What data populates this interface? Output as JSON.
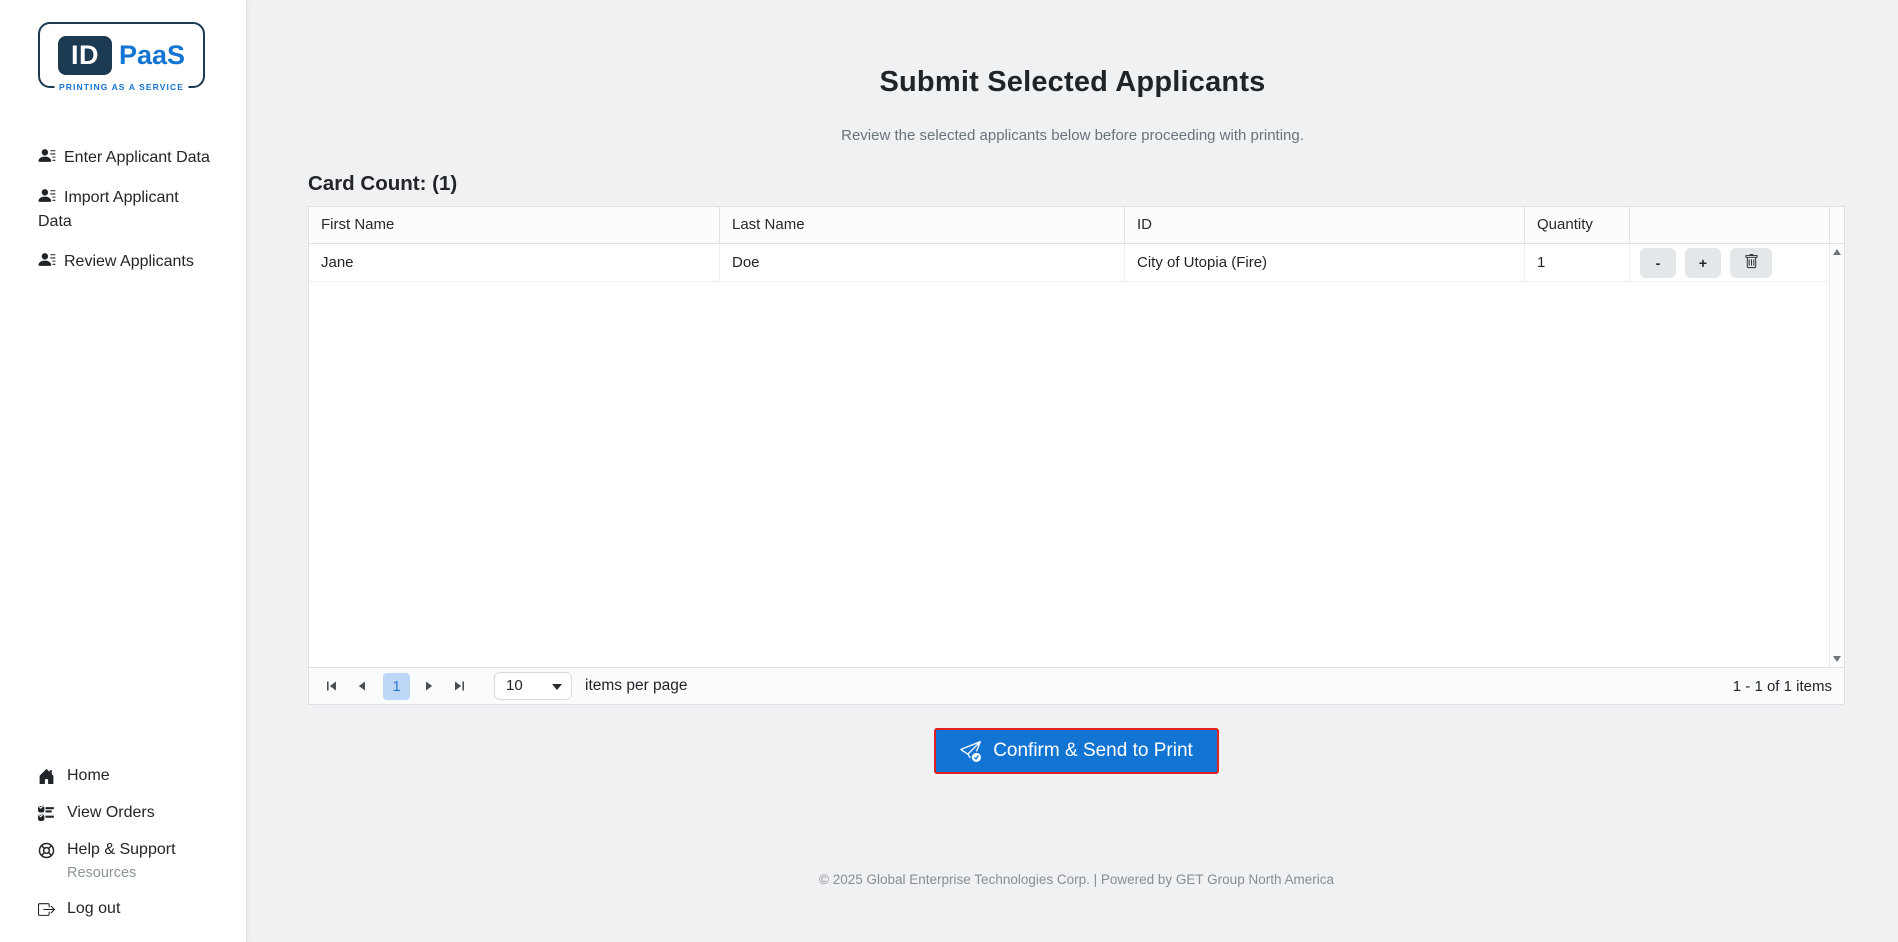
{
  "logo": {
    "id": "ID",
    "paas": "PaaS",
    "tagline": "PRINTING AS A SERVICE"
  },
  "sidebar": {
    "nav_top": [
      {
        "label": "Enter Applicant Data",
        "icon": "person-lines-icon"
      },
      {
        "label": "Import Applicant Data",
        "icon": "person-lines-icon"
      },
      {
        "label": "Review Applicants",
        "icon": "person-lines-icon"
      }
    ],
    "nav_bottom": [
      {
        "label": "Home",
        "icon": "home-icon"
      },
      {
        "label": "View Orders",
        "icon": "orders-checklist-icon"
      },
      {
        "label": "Help & Support",
        "icon": "life-preserver-icon",
        "sublabel": "Resources"
      },
      {
        "label": "Log out",
        "icon": "logout-icon"
      }
    ]
  },
  "main": {
    "title": "Submit Selected Applicants",
    "subtitle": "Review the selected applicants below before proceeding with printing.",
    "card_count_label": "Card Count: (1)",
    "table": {
      "columns": [
        "First Name",
        "Last Name",
        "ID",
        "Quantity"
      ],
      "rows": [
        {
          "first_name": "Jane",
          "last_name": "Doe",
          "id": "City of Utopia (Fire)",
          "quantity": "1"
        }
      ],
      "row_actions": {
        "decrease": "-",
        "increase": "+",
        "delete": "trash-icon"
      }
    },
    "pager": {
      "current_page": "1",
      "page_size": "10",
      "items_per_page_label": "items per page",
      "range_label": "1 - 1 of 1 items"
    },
    "confirm_button_label": "Confirm & Send to Print"
  },
  "footer": {
    "text": "© 2025 Global Enterprise Technologies Corp. | Powered by GET Group North America"
  },
  "colors": {
    "primary_blue": "#1274d3",
    "logo_navy": "#1c3a52",
    "confirm_outline_red": "#e12020",
    "selected_page_bg": "#bdd8f6",
    "selected_page_text": "#2f76d2",
    "muted_text": "#6a737b"
  }
}
